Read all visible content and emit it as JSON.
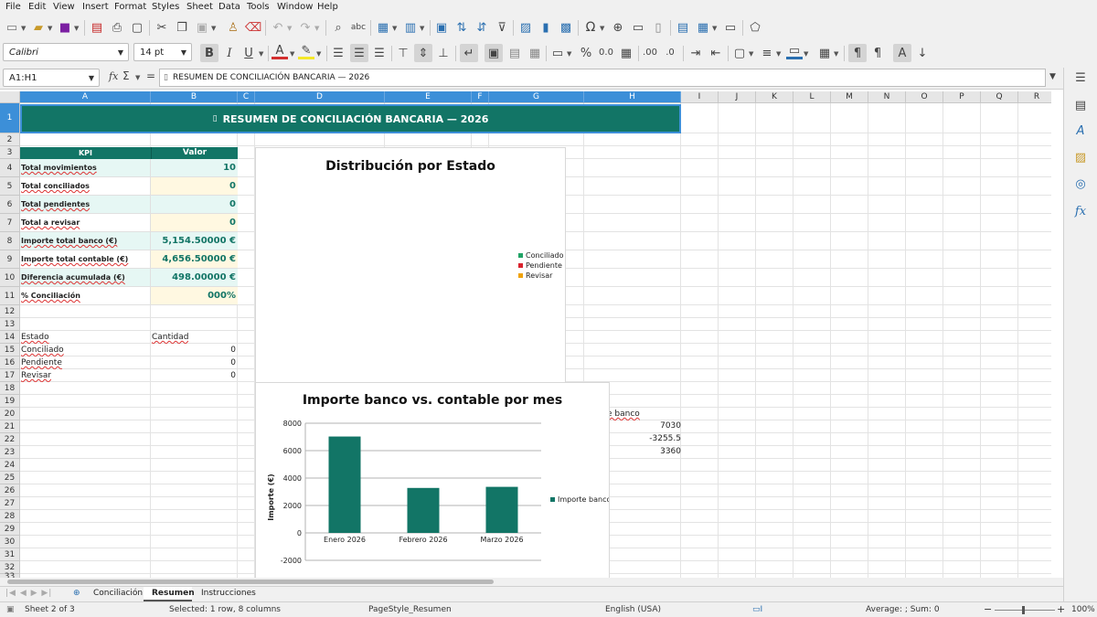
{
  "menu": [
    "File",
    "Edit",
    "View",
    "Insert",
    "Format",
    "Styles",
    "Sheet",
    "Data",
    "Tools",
    "Window",
    "Help"
  ],
  "toolbar": {
    "font_name": "Calibri",
    "font_size": "14 pt"
  },
  "formula_bar": {
    "name_box": "A1:H1",
    "content": "RESUMEN DE CONCILIACIÓN BANCARIA — 2026",
    "fx": "fx",
    "sum": "Σ",
    "eq": "="
  },
  "columns": [
    "A",
    "B",
    "C",
    "D",
    "E",
    "F",
    "G",
    "H",
    "I",
    "J",
    "K",
    "L",
    "M",
    "N",
    "O",
    "P",
    "Q",
    "R"
  ],
  "rows": [
    "1",
    "2",
    "3",
    "4",
    "5",
    "6",
    "7",
    "8",
    "9",
    "10",
    "11",
    "12",
    "13",
    "14",
    "15",
    "16",
    "17",
    "18",
    "19",
    "20",
    "21",
    "22",
    "23",
    "24",
    "25",
    "26",
    "27",
    "28",
    "29",
    "30",
    "31",
    "32",
    "33"
  ],
  "sheet": {
    "title": "RESUMEN DE CONCILIACIÓN BANCARIA — 2026",
    "title_icon": "▯",
    "kpi_header": {
      "kpi": "KPI",
      "valor": "Valor"
    },
    "kpis": [
      {
        "label": "Total movimientos",
        "value": "10"
      },
      {
        "label": "Total conciliados",
        "value": "0"
      },
      {
        "label": "Total pendientes",
        "value": "0"
      },
      {
        "label": "Total a revisar",
        "value": "0"
      },
      {
        "label": "Importe total banco (€)",
        "value": "5,154.50000 €"
      },
      {
        "label": "Importe total contable (€)",
        "value": "4,656.50000 €"
      },
      {
        "label": "Diferencia acumulada (€)",
        "value": "498.00000 €"
      },
      {
        "label": "% Conciliación",
        "value": "000%"
      }
    ],
    "estado_header": {
      "estado": "Estado",
      "cantidad": "Cantidad"
    },
    "estados": [
      {
        "label": "Conciliado",
        "value": "0"
      },
      {
        "label": "Pendiente",
        "value": "0"
      },
      {
        "label": "Revisar",
        "value": "0"
      }
    ],
    "right_fragment": "e banco",
    "right_values": [
      "7030",
      "-3255.5",
      "3360"
    ],
    "theme_colors": {
      "teal": "#127566",
      "light_cyan": "#e6f7f4",
      "light_yellow": "#fff8e1",
      "value_teal": "#127566"
    }
  },
  "chart_data": [
    {
      "type": "pie",
      "title": "Distribución por Estado",
      "categories": [
        "Conciliado",
        "Pendiente",
        "Revisar"
      ],
      "values": [
        0,
        0,
        0
      ],
      "colors": [
        "#21a366",
        "#d9232e",
        "#f0a30a"
      ],
      "legend_position": "right"
    },
    {
      "type": "bar",
      "title": "Importe banco vs. contable por mes",
      "categories": [
        "Enero 2026",
        "Febrero 2026",
        "Marzo 2026"
      ],
      "series": [
        {
          "name": "Importe banco",
          "values": [
            7030,
            3280,
            3360
          ]
        }
      ],
      "ylabel": "Importe (€)",
      "ylim": [
        -2000,
        8000
      ],
      "yticks": [
        "8000",
        "6000",
        "4000",
        "2000",
        "0",
        "-2000"
      ],
      "color": "#127566",
      "grid": true,
      "legend_position": "right"
    }
  ],
  "tabs": [
    "Conciliación",
    "Resumen",
    "Instrucciones"
  ],
  "active_tab": "Resumen",
  "status": {
    "sheet": "Sheet 2 of 3",
    "selection": "Selected: 1 row, 8 columns",
    "pagestyle": "PageStyle_Resumen",
    "language": "English (USA)",
    "stats": "Average: ; Sum: 0",
    "zoom": "100%"
  }
}
